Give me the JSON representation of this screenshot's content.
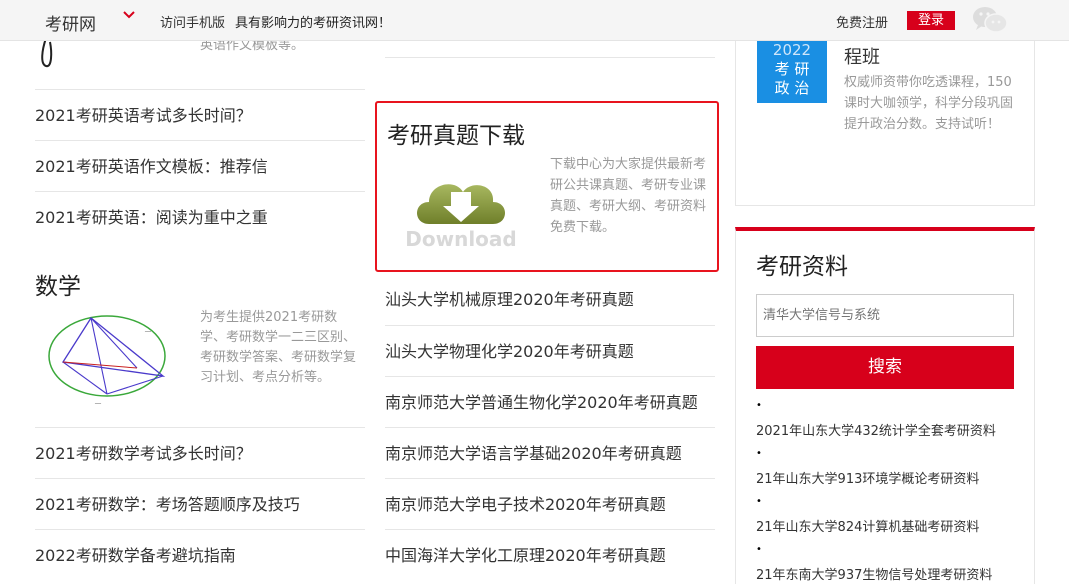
{
  "topbar": {
    "site_name": "考研网",
    "mobile_link": "访问手机版",
    "slogan": "具有影响力的考研资讯网！",
    "register": "免费注册",
    "login": "登录"
  },
  "left": {
    "partial_text": "英语作文模板等。",
    "english_links": [
      "2021考研英语考试多长时间？",
      "2021考研英语作文模板：推荐信",
      "2021考研英语：阅读为重中之重"
    ],
    "math_title": "数学",
    "math_desc": "为考生提供2021考研数学、考研数学一二三区别、考研数学答案、考研数学复习计划、考点分析等。",
    "math_links": [
      "2021考研数学考试多长时间？",
      "2021考研数学：考场答题顺序及技巧",
      "2022考研数学备考避坑指南"
    ]
  },
  "middle": {
    "download_title": "考研真题下载",
    "download_desc": "下载中心为大家提供最新考研公共课真题、考研专业课真题、考研大纲、考研资料免费下载。",
    "download_image_text": "Download",
    "links": [
      "汕头大学机械原理2020年考研真题",
      "汕头大学物理化学2020年考研真题",
      "南京师范大学普通生物化学2020年考研真题",
      "南京师范大学语言学基础2020年考研真题",
      "南京师范大学电子技术2020年考研真题",
      "中国海洋大学化工原理2020年考研真题"
    ]
  },
  "right": {
    "course_badge": [
      "2022",
      "考 研",
      "政 治"
    ],
    "course_title": "程班",
    "course_desc": "权威师资带你吃透课程，150课时大咖领学，科学分段巩固提升政治分数。支持试听！",
    "resources_title": "考研资料",
    "search_placeholder": "清华大学信号与系统",
    "search_button": "搜索",
    "bullet": "•",
    "items": [
      "2021年山东大学432统计学全套考研资料",
      "21年山东大学913环境学概论考研资料",
      "21年山东大学824计算机基础考研资料",
      "21年东南大学937生物信号处理考研资料"
    ]
  },
  "colors": {
    "brand_red": "#d7001b",
    "highlight_border": "#e8141e",
    "badge_blue": "#1a8fe3"
  }
}
